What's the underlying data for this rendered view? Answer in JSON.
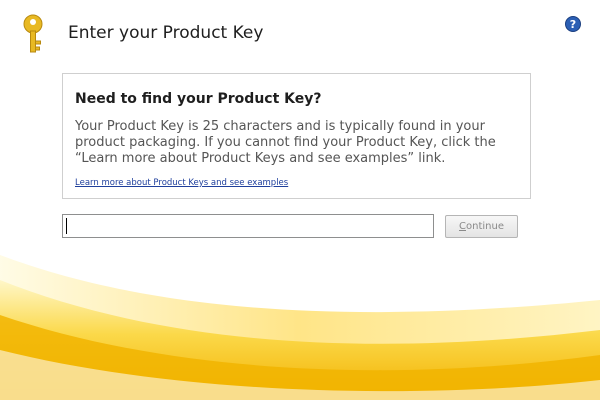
{
  "dialog": {
    "title": "Enter your Product Key"
  },
  "help": {
    "glyph": "?"
  },
  "info_box": {
    "heading": "Need to find your Product Key?",
    "body": "Your Product Key is 25 characters and is typically found in your product packaging. If you cannot find your Product Key, click the “Learn more about Product Keys and see examples” link.",
    "link": "Learn more about Product Keys and see examples"
  },
  "product_key_input": {
    "value": "",
    "placeholder": ""
  },
  "continue_button": {
    "label_first": "C",
    "label_rest": "ontinue",
    "enabled": false
  },
  "colors": {
    "accent_yellow": "#f5c400",
    "key_gold": "#e8b923",
    "help_blue": "#2b5fb4",
    "link_blue": "#1f3f9c"
  },
  "icons": {
    "key": "key-icon",
    "help": "help-icon"
  }
}
